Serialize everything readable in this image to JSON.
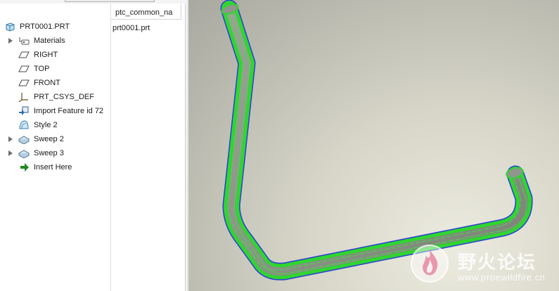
{
  "model_tree": {
    "column_header": "ptc_common_na",
    "root": {
      "label": "PRT0001.PRT",
      "value": "prt0001.prt",
      "icon": "part-icon"
    },
    "items": [
      {
        "label": "Materials",
        "icon": "materials-icon",
        "expandable": true
      },
      {
        "label": "RIGHT",
        "icon": "datum-plane-icon",
        "expandable": false
      },
      {
        "label": "TOP",
        "icon": "datum-plane-icon",
        "expandable": false
      },
      {
        "label": "FRONT",
        "icon": "datum-plane-icon",
        "expandable": false
      },
      {
        "label": "PRT_CSYS_DEF",
        "icon": "coordinate-system-icon",
        "expandable": false
      },
      {
        "label": "Import Feature id 72",
        "icon": "import-feature-icon",
        "expandable": false
      },
      {
        "label": "Style 2",
        "icon": "style-surface-icon",
        "expandable": false
      },
      {
        "label": "Sweep 2",
        "icon": "sweep-icon",
        "expandable": true
      },
      {
        "label": "Sweep 3",
        "icon": "sweep-icon",
        "expandable": true
      },
      {
        "label": "Insert Here",
        "icon": "insert-arrow-icon",
        "expandable": false
      }
    ]
  },
  "watermark": {
    "title": "野火论坛",
    "url": "www.proewildfire.cn"
  },
  "colors": {
    "pipe_highlight": "#2fd62f",
    "pipe_body": "#8f968c",
    "pipe_edge": "#2b3bd6",
    "insert_arrow": "#1e8a1e"
  }
}
